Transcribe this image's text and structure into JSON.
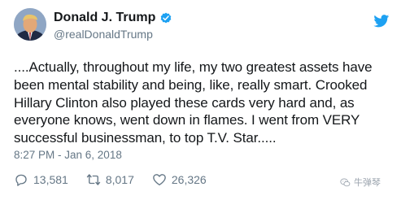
{
  "user": {
    "display_name": "Donald J. Trump",
    "handle": "@realDonaldTrump",
    "avatar_icon": "profile-photo",
    "verified_icon": "verified-badge-icon",
    "verified_color": "#1da1f2"
  },
  "platform_icon": "twitter-bird-icon",
  "brand_color": "#1da1f2",
  "tweet": {
    "text_lines": [
      "....Actually, throughout my life, my two greatest assets have",
      "been mental stability and being, like, really smart. Crooked",
      "Hillary Clinton also played these cards very hard and, as",
      "everyone knows, went down in flames. I went from VERY",
      "successful businessman, to top T.V. Star....."
    ],
    "timestamp": "8:27 PM - Jan 6, 2018"
  },
  "actions": {
    "reply_count": "13,581",
    "retweet_count": "8,017",
    "like_count": "26,326"
  },
  "watermark": {
    "icon": "wechat-icon",
    "text": "牛弹琴"
  }
}
